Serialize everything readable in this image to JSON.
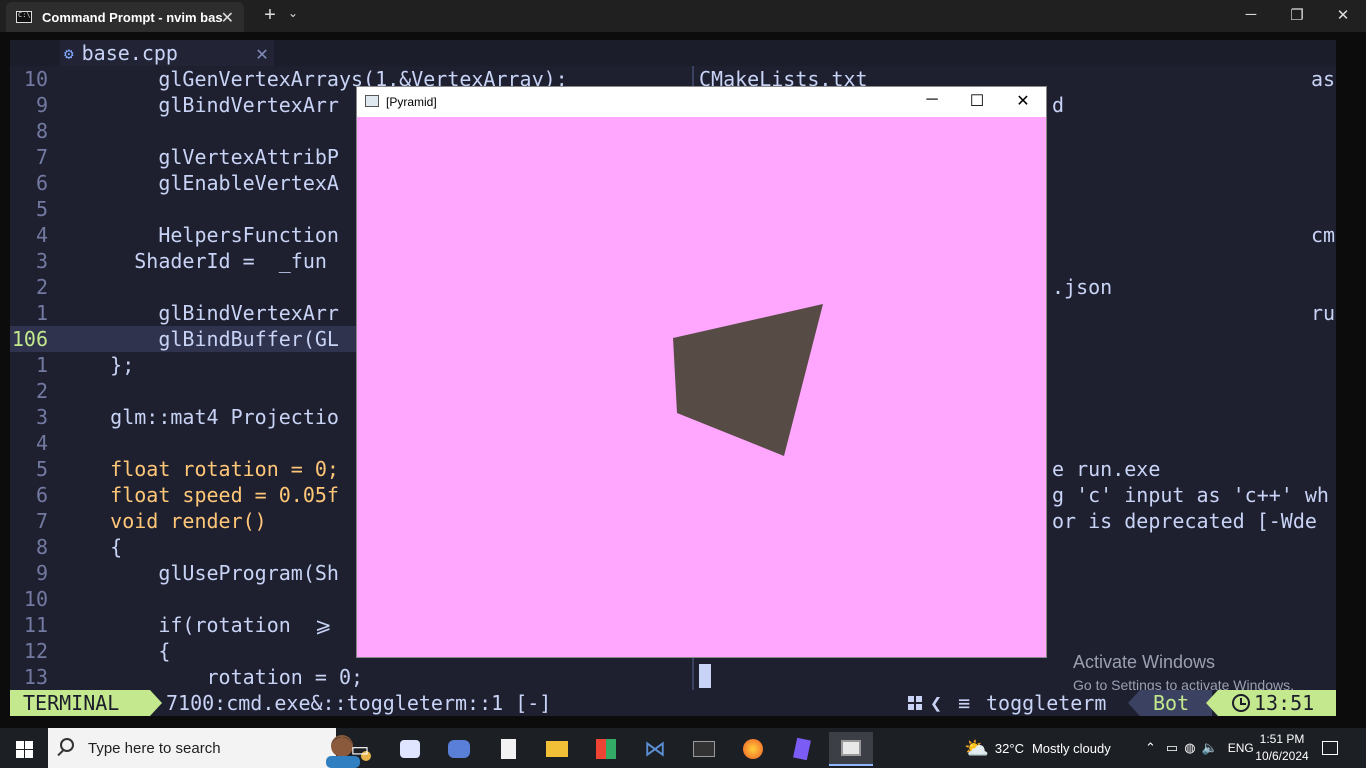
{
  "terminal": {
    "tab_title": "Command Prompt - nvim  bas",
    "close_glyph": "✕",
    "new_tab_glyph": "+",
    "dropdown_glyph": "⌄",
    "minimize_glyph": "─",
    "maximize_glyph": "❐",
    "window_close_glyph": "✕"
  },
  "buffer_tab": {
    "name": "base.cpp",
    "close_glyph": "✕",
    "icon": "cpp-file-icon"
  },
  "code_lines": [
    {
      "num": "10",
      "text": "        glGenVertexArrays(1,&VertexArray);"
    },
    {
      "num": "9",
      "text": "        glBindVertexArr"
    },
    {
      "num": "8",
      "text": ""
    },
    {
      "num": "7",
      "text": "        glVertexAttribP"
    },
    {
      "num": "6",
      "text": "        glEnableVertexA"
    },
    {
      "num": "5",
      "text": ""
    },
    {
      "num": "4",
      "text": "        HelpersFunction"
    },
    {
      "num": "3",
      "text": "      ShaderId =  _fun"
    },
    {
      "num": "2",
      "text": ""
    },
    {
      "num": "1",
      "text": "        glBindVertexArr"
    },
    {
      "num": "106",
      "text": "        glBindBuffer(GL"
    },
    {
      "num": "1",
      "text": "    };"
    },
    {
      "num": "2",
      "text": ""
    },
    {
      "num": "3",
      "text": "    glm::mat4 Projectio"
    },
    {
      "num": "4",
      "text": ""
    },
    {
      "num": "5",
      "text": "    float rotation = 0;"
    },
    {
      "num": "6",
      "text": "    float speed = 0.05f"
    },
    {
      "num": "7",
      "text": "    void render()"
    },
    {
      "num": "8",
      "text": "    {"
    },
    {
      "num": "9",
      "text": "        glUseProgram(Sh"
    },
    {
      "num": "10",
      "text": ""
    },
    {
      "num": "11",
      "text": "        if(rotation  ⩾"
    },
    {
      "num": "12",
      "text": "        {"
    },
    {
      "num": "13",
      "text": "            rotation = 0;"
    }
  ],
  "term_lines": [
    {
      "text": "CMakeLists.txt",
      "right": "as",
      "right_at": 612
    },
    {
      "text": "",
      "right": "d",
      "right_at": 353
    },
    {
      "text": ""
    },
    {
      "text": ""
    },
    {
      "text": ""
    },
    {
      "text": ""
    },
    {
      "text": "",
      "right": "cm",
      "right_at": 612
    },
    {
      "text": ""
    },
    {
      "text": "",
      "right": ".json",
      "right_at": 353
    },
    {
      "text": "",
      "right": "ru",
      "right_at": 612
    },
    {
      "text": ""
    },
    {
      "text": ""
    },
    {
      "text": ""
    },
    {
      "text": ""
    },
    {
      "text": ""
    },
    {
      "text": "",
      "right": "e run.exe",
      "right_at": 353
    },
    {
      "text": "",
      "right": "g 'c' input as 'c++' wh",
      "right_at": 353
    },
    {
      "text": "",
      "right": "or is deprecated [-Wde",
      "right_at": 353
    }
  ],
  "watermark": {
    "line1": "Activate Windows",
    "line2": "Go to Settings to activate Windows."
  },
  "statusline": {
    "mode": "TERMINAL",
    "buffer": "7100:cmd.exe&::toggleterm::1 [-]",
    "filetype": "toggleterm",
    "position": "Bot",
    "time": "13:51"
  },
  "pyramid_window": {
    "title": "[Pyramid]",
    "minimize_glyph": "─",
    "maximize_glyph": "☐",
    "close_glyph": "✕",
    "background_color": "#ffa6ff",
    "shape_color": "#574b45"
  },
  "taskbar": {
    "search_placeholder": "Type here to search",
    "weather_temp": "32°C",
    "weather_text": "Mostly cloudy",
    "language": "ENG",
    "time": "1:51 PM",
    "date": "10/6/2024",
    "apps": [
      "task-view-icon",
      "messenger-icon",
      "discord-icon",
      "file-icon",
      "file-explorer-icon",
      "office-icon",
      "vscode-icon",
      "terminal-icon",
      "firefox-icon",
      "obsidian-icon",
      "window-app-icon"
    ]
  }
}
